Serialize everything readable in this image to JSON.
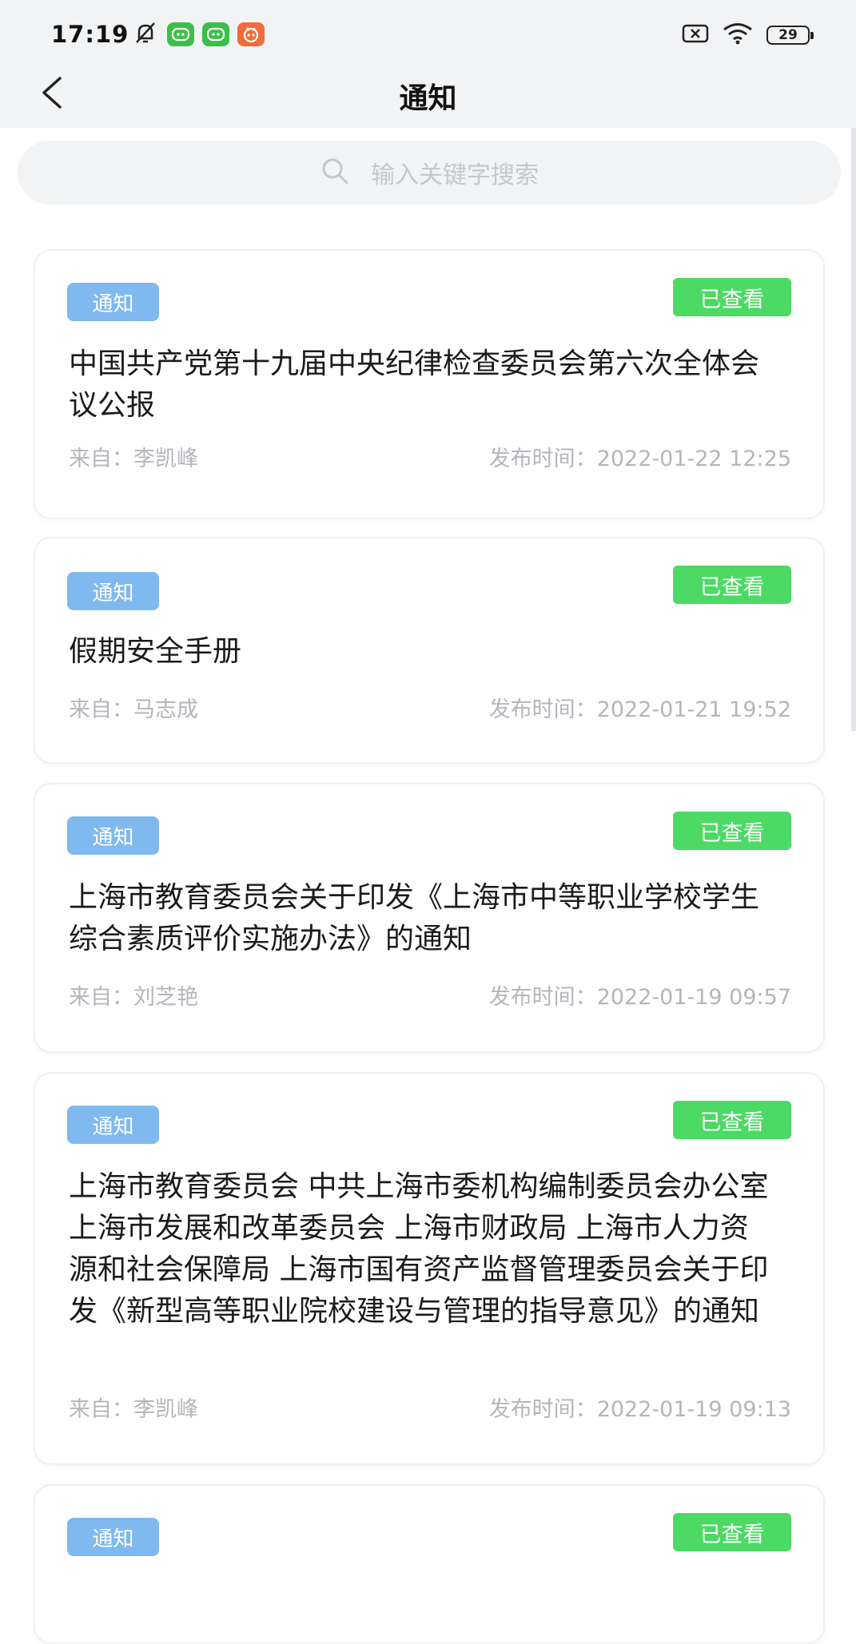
{
  "status_bar": {
    "time": "17:19",
    "battery": "29"
  },
  "header": {
    "title": "通知"
  },
  "search": {
    "placeholder": "输入关键字搜索"
  },
  "labels": {
    "from_prefix": "来自：",
    "time_prefix": "发布时间："
  },
  "notices": [
    {
      "tag": "通知",
      "status": "已查看",
      "title": "中国共产党第十九届中央纪律检查委员会第六次全体会议公报",
      "from": "李凯峰",
      "time": "2022-01-22 12:25"
    },
    {
      "tag": "通知",
      "status": "已查看",
      "title": "假期安全手册",
      "from": "马志成",
      "time": "2022-01-21 19:52"
    },
    {
      "tag": "通知",
      "status": "已查看",
      "title": "上海市教育委员会关于印发《上海市中等职业学校学生综合素质评价实施办法》的通知",
      "from": "刘芝艳",
      "time": "2022-01-19 09:57"
    },
    {
      "tag": "通知",
      "status": "已查看",
      "title": "上海市教育委员会 中共上海市委机构编制委员会办公室 上海市发展和改革委员会 上海市财政局 上海市人力资源和社会保障局 上海市国有资产监督管理委员会关于印发《新型高等职业院校建设与管理的指导意见》的通知",
      "from": "李凯峰",
      "time": "2022-01-19 09:13"
    },
    {
      "tag": "通知",
      "status": "已查看"
    }
  ],
  "colors": {
    "tag_bg": "#7fb9ef",
    "viewed_badge": "#4cd964",
    "header_bg": "#f2f3f5"
  }
}
